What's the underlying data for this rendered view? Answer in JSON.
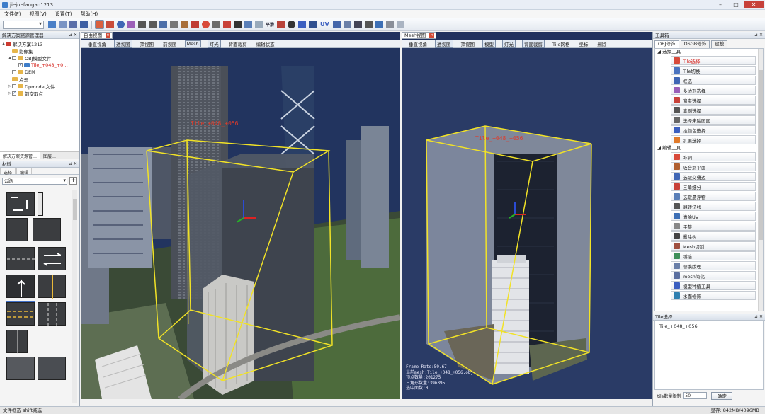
{
  "window": {
    "title": "jiejuefangan1213"
  },
  "menu": [
    "文件(F)",
    "视图(V)",
    "设置(T)",
    "帮助(H)"
  ],
  "toolbar": {
    "text_tool": "平滑",
    "uv_tool": "UV"
  },
  "left_panel": {
    "title": "解决方案资源管理器",
    "tree": [
      {
        "label": "解决方案1213",
        "level": 0,
        "icon": "solution-icon",
        "expand": "▲",
        "checkbox": false,
        "checked": false
      },
      {
        "label": "影像集",
        "level": 1,
        "icon": "folder-icon",
        "expand": "",
        "checkbox": false,
        "checked": false
      },
      {
        "label": "OBJ模型文件",
        "level": 1,
        "icon": "folder-icon",
        "expand": "▲",
        "checkbox": true,
        "checked": false
      },
      {
        "label": "Tile_+048_+0…",
        "level": 2,
        "icon": "model-icon",
        "expand": "",
        "checkbox": true,
        "checked": true,
        "highlight": true
      },
      {
        "label": "DEM",
        "level": 1,
        "icon": "folder-icon",
        "expand": "",
        "checkbox": true,
        "checked": false
      },
      {
        "label": "点云",
        "level": 1,
        "icon": "folder-icon",
        "expand": "",
        "checkbox": false,
        "checked": false
      },
      {
        "label": "Dpmodel文件",
        "level": 1,
        "icon": "folder-icon",
        "expand": "▷",
        "checkbox": true,
        "checked": false
      },
      {
        "label": "前交取点",
        "level": 1,
        "icon": "folder-icon",
        "expand": "▷",
        "checkbox": true,
        "checked": true
      }
    ],
    "bottom_tabs": [
      "解决方案资源管…",
      "图层…"
    ],
    "materials_title": "材料",
    "material_tabs": [
      "选择",
      "编辑"
    ],
    "material_category": "公路"
  },
  "view_left": {
    "tab_label": "自由视图",
    "toolbar": [
      "垂直视角",
      "透视图",
      "顶视图",
      "前视图",
      "Mesh",
      "灯光",
      "背面裁剪",
      "编辑状态"
    ],
    "active": [
      "透视图",
      "Mesh",
      "灯光"
    ],
    "tile_label": "Tile_+048_+056"
  },
  "view_right": {
    "tab_label": "Mesh视图",
    "toolbar": [
      "垂直视角",
      "透视图",
      "顶视图",
      "模型",
      "灯光",
      "背面裁剪",
      "Tile网格",
      "坐标",
      "删除"
    ],
    "active": [
      "透视图",
      "模型",
      "灯光",
      "背面裁剪"
    ],
    "tile_label": "Tile_+048_+056",
    "info": [
      "Frame Rate:59.67",
      "当前mesh:Tile_+048_+056.obj",
      "顶点数量:201275",
      "三角形数量:396395",
      "选中面数:0"
    ]
  },
  "right_panel": {
    "title": "工具箱",
    "tabs": [
      "OBJ修饰",
      "OSGB修饰",
      "建模"
    ],
    "groups": [
      {
        "name": "选择工具",
        "tools": [
          {
            "label": "Tile选择",
            "icon": "tile-select-icon",
            "highlight": true
          },
          {
            "label": "Tile切换",
            "icon": "tile-switch-icon"
          },
          {
            "label": "框选",
            "icon": "box-select-icon"
          },
          {
            "label": "多边形选择",
            "icon": "polygon-select-icon"
          },
          {
            "label": "窗实选择",
            "icon": "window-select-icon"
          },
          {
            "label": "笔刷选择",
            "icon": "brush-select-icon"
          },
          {
            "label": "选择未贴图面",
            "icon": "untextured-select-icon"
          },
          {
            "label": "拾颜色选择",
            "icon": "color-select-icon"
          },
          {
            "label": "扩展选择",
            "icon": "expand-select-icon"
          }
        ]
      },
      {
        "name": "编辑工具",
        "tools": [
          {
            "label": "补洞",
            "icon": "fill-hole-icon"
          },
          {
            "label": "吸合到平面",
            "icon": "snap-plane-icon"
          },
          {
            "label": "选取交叠边",
            "icon": "overlap-edge-icon"
          },
          {
            "label": "三角细分",
            "icon": "subdivide-icon"
          },
          {
            "label": "选取悬浮物",
            "icon": "floating-select-icon"
          },
          {
            "label": "翻转法线",
            "icon": "flip-normal-icon"
          },
          {
            "label": "清除UV",
            "icon": "clear-uv-icon"
          },
          {
            "label": "平整",
            "icon": "flatten-icon"
          },
          {
            "label": "删除树",
            "icon": "delete-tree-icon"
          },
          {
            "label": "Mesh切割",
            "icon": "mesh-cut-icon"
          },
          {
            "label": "桥接",
            "icon": "bridge-icon"
          },
          {
            "label": "替换纹理",
            "icon": "replace-texture-icon"
          },
          {
            "label": "mesh简化",
            "icon": "mesh-simplify-icon"
          },
          {
            "label": "模型种植工具",
            "icon": "plant-tool-icon"
          },
          {
            "label": "水面修饰",
            "icon": "water-icon"
          }
        ]
      }
    ],
    "tile_select_title": "Tile选择",
    "tile_select_value": "Tile_+048_+056",
    "tile_count_label": "tile数量限制",
    "tile_count_value": "50",
    "ok_label": "确定"
  },
  "status": {
    "left": "文件框选  shift减选",
    "right": "显存: 842MB/4096MB"
  }
}
